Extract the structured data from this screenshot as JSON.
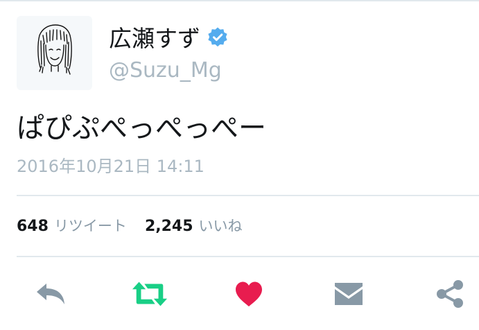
{
  "tweet": {
    "display_name": "広瀬すず",
    "handle": "@Suzu_Mg",
    "text": "ぱぴぷぺっぺっぺー",
    "timestamp": "2016年10月21日 14:11"
  },
  "stats": {
    "retweets_count": "648",
    "retweets_label": "リツイート",
    "likes_count": "2,245",
    "likes_label": "いいね"
  },
  "actions": [
    {
      "icon": "reply-icon"
    },
    {
      "icon": "retweet-icon"
    },
    {
      "icon": "heart-icon"
    },
    {
      "icon": "envelope-icon"
    },
    {
      "icon": "share-icon"
    }
  ],
  "colors": {
    "text": "#14171a",
    "muted": "#aab8c2",
    "label": "#8899a6",
    "verified": "#55acee",
    "retweet_active": "#19cf86",
    "like_active": "#e81c4f",
    "action_gray": "#8899a6",
    "divider": "#e1e8ed"
  }
}
